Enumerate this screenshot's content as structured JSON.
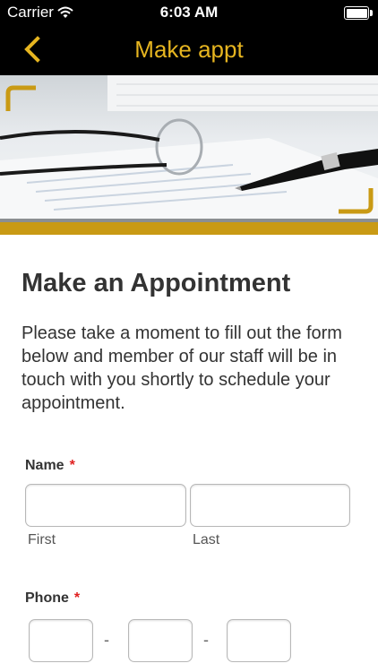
{
  "status_bar": {
    "carrier": "Carrier",
    "time": "6:03 AM"
  },
  "nav": {
    "title": "Make appt",
    "back_icon": "chevron-left-icon"
  },
  "colors": {
    "accent": "#e6b520",
    "stripe": "#c99a14",
    "required": "#e02020"
  },
  "form": {
    "heading": "Make an Appointment",
    "intro": "Please take a moment to fill out the form below and member of our staff will be in touch with you shortly to schedule your appointment.",
    "name": {
      "label": "Name",
      "required_mark": "*",
      "first_value": "",
      "last_value": "",
      "first_sublabel": "First",
      "last_sublabel": "Last"
    },
    "phone": {
      "label": "Phone",
      "required_mark": "*",
      "separator": "-",
      "part1_value": "",
      "part2_value": "",
      "part3_value": ""
    }
  }
}
